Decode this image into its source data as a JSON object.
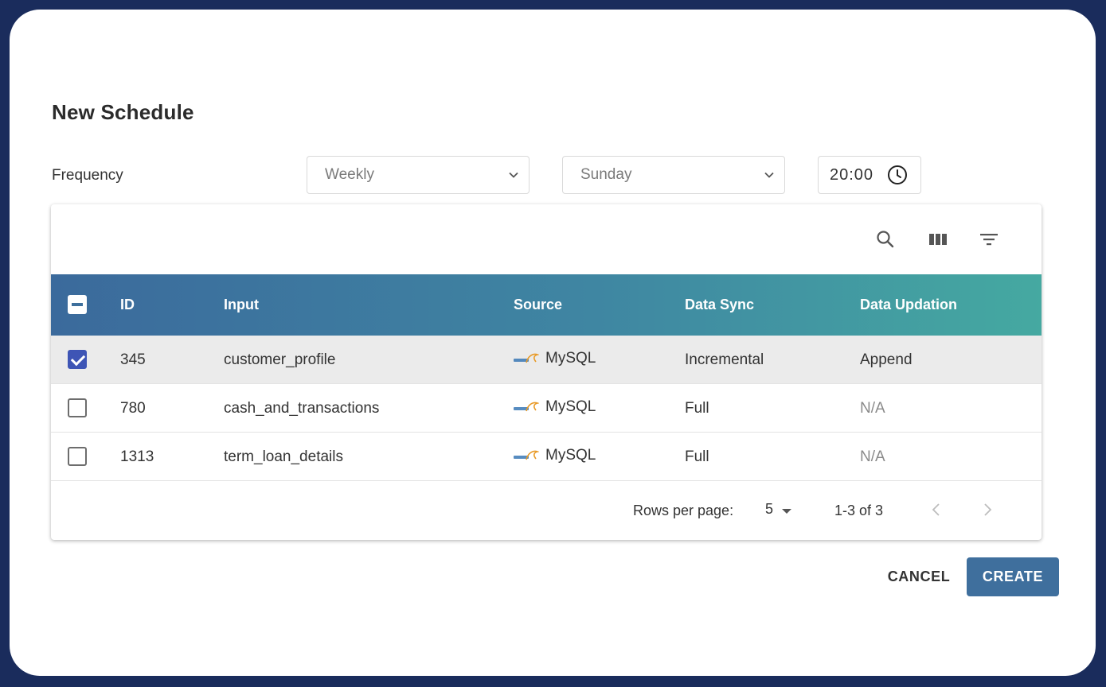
{
  "dialog": {
    "title": "New Schedule",
    "frequency_label": "Frequency",
    "frequency_value": "Weekly",
    "day_value": "Sunday",
    "time_value": "20:00"
  },
  "table": {
    "columns": {
      "id": "ID",
      "input": "Input",
      "source": "Source",
      "data_sync": "Data Sync",
      "data_updation": "Data Updation"
    },
    "rows": [
      {
        "checked": true,
        "id": "345",
        "input": "customer_profile",
        "source": "MySQL",
        "data_sync": "Incremental",
        "data_updation": "Append"
      },
      {
        "checked": false,
        "id": "780",
        "input": "cash_and_transactions",
        "source": "MySQL",
        "data_sync": "Full",
        "data_updation": "N/A"
      },
      {
        "checked": false,
        "id": "1313",
        "input": "term_loan_details",
        "source": "MySQL",
        "data_sync": "Full",
        "data_updation": "N/A"
      }
    ],
    "footer": {
      "rows_per_page_label": "Rows per page:",
      "rows_per_page_value": "5",
      "range": "1-3 of 3"
    }
  },
  "actions": {
    "cancel": "CANCEL",
    "create": "CREATE"
  },
  "colors": {
    "frame": "#1a2c5c",
    "header_start": "#3b6a9c",
    "header_end": "#45a9a1",
    "checkbox_checked": "#3e55b5",
    "create_button": "#3f6f9d"
  },
  "icons": {
    "time": "clock-icon",
    "search": "search-icon",
    "columns": "view-column-icon",
    "filter": "filter-list-icon",
    "source": "mysql-logo-icon",
    "prev": "chevron-left-icon",
    "next": "chevron-right-icon"
  }
}
